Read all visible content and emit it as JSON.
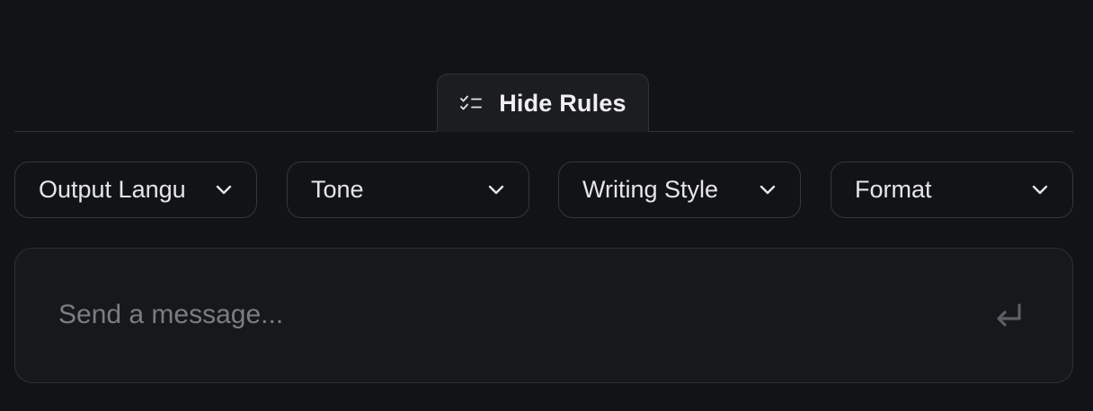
{
  "rules_toggle": {
    "label": "Hide Rules",
    "icon": "checklist-icon"
  },
  "dropdowns": [
    {
      "label": "Output Langu",
      "icon": "chevron-down-icon"
    },
    {
      "label": "Tone",
      "icon": "chevron-down-icon"
    },
    {
      "label": "Writing Style",
      "icon": "chevron-down-icon"
    },
    {
      "label": "Format",
      "icon": "chevron-down-icon"
    }
  ],
  "composer": {
    "placeholder": "Send a message...",
    "value": "",
    "send_icon": "enter-return-icon"
  },
  "colors": {
    "background": "#111316",
    "panel": "#1b1d20",
    "border": "#2e3136",
    "text": "#e6e6e6",
    "placeholder": "#7a7d81",
    "send_icon": "#5c5f63"
  }
}
